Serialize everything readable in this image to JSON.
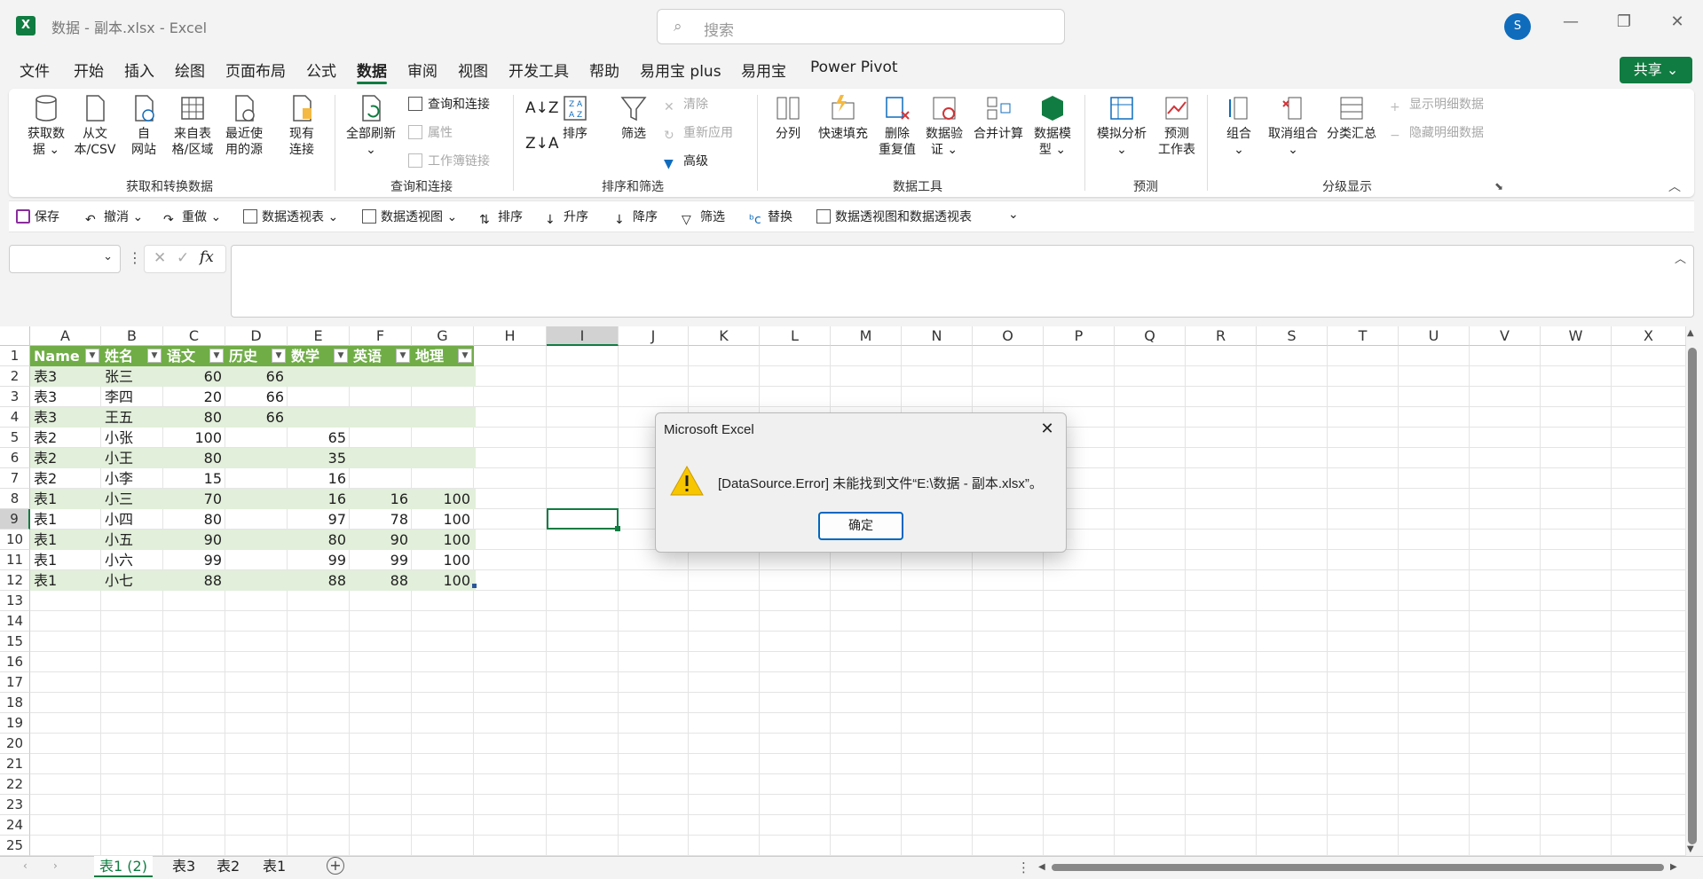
{
  "window": {
    "title": "数据 - 副本.xlsx  -  Excel",
    "logo": "X",
    "search_placeholder": "搜索",
    "avatar": "S"
  },
  "tabs": [
    "文件",
    "开始",
    "插入",
    "绘图",
    "页面布局",
    "公式",
    "数据",
    "审阅",
    "视图",
    "开发工具",
    "帮助",
    "易用宝 plus",
    "易用宝",
    "Power Pivot"
  ],
  "active_tab": "数据",
  "share_label": "共享",
  "ribbon": {
    "get_data": [
      "获取数",
      "据"
    ],
    "from_text": [
      "从文",
      "本/CSV"
    ],
    "from_web": [
      "自",
      "网站"
    ],
    "from_table": [
      "来自表",
      "格/区域"
    ],
    "recent": [
      "最近使",
      "用的源"
    ],
    "existing": [
      "现有",
      "连接"
    ],
    "refresh_all": [
      "全部刷新"
    ],
    "queries_connections": "查询和连接",
    "properties": "属性",
    "workbook_links": "工作簿链接",
    "sort": "排序",
    "filter": "筛选",
    "clear": "清除",
    "reapply": "重新应用",
    "advanced": "高级",
    "split": "分列",
    "flash_fill": "快速填充",
    "remove_dup": [
      "删除",
      "重复值"
    ],
    "validation": [
      "数据验",
      "证"
    ],
    "consolidate": "合并计算",
    "data_model": [
      "数据模",
      "型"
    ],
    "whatif": [
      "模拟分析"
    ],
    "forecast": [
      "预测",
      "工作表"
    ],
    "group": "组合",
    "ungroup": "取消组合",
    "subtotal": "分类汇总",
    "show_detail": "显示明细数据",
    "hide_detail": "隐藏明细数据",
    "groups": [
      "获取和转换数据",
      "查询和连接",
      "排序和筛选",
      "数据工具",
      "预测",
      "分级显示"
    ]
  },
  "qat": {
    "save": "保存",
    "undo": "撤消",
    "redo": "重做",
    "pivot_table": "数据透视表",
    "pivot_chart": "数据透视图",
    "sort": "排序",
    "asc": "升序",
    "desc": "降序",
    "filter": "筛选",
    "replace": "替换",
    "pivot_both": "数据透视图和数据透视表"
  },
  "formula_bar": {
    "fx": "fx"
  },
  "columns": [
    "A",
    "B",
    "C",
    "D",
    "E",
    "F",
    "G",
    "H",
    "I",
    "J",
    "K",
    "L",
    "M",
    "N",
    "O",
    "P",
    "Q",
    "R",
    "S",
    "T",
    "U",
    "V",
    "W",
    "X"
  ],
  "row_numbers": [
    "1",
    "2",
    "3",
    "4",
    "5",
    "6",
    "7",
    "8",
    "9",
    "10",
    "11",
    "12",
    "13",
    "14",
    "15",
    "16",
    "17",
    "18",
    "19",
    "20",
    "21",
    "22",
    "23",
    "24",
    "25"
  ],
  "table": {
    "headers": [
      "Name",
      "姓名",
      "语文",
      "历史",
      "数学",
      "英语",
      "地理"
    ],
    "rows": [
      [
        "表3",
        "张三",
        "60",
        "66",
        "",
        "",
        ""
      ],
      [
        "表3",
        "李四",
        "20",
        "66",
        "",
        "",
        ""
      ],
      [
        "表3",
        "王五",
        "80",
        "66",
        "",
        "",
        ""
      ],
      [
        "表2",
        "小张",
        "100",
        "",
        "65",
        "",
        ""
      ],
      [
        "表2",
        "小王",
        "80",
        "",
        "35",
        "",
        ""
      ],
      [
        "表2",
        "小李",
        "15",
        "",
        "16",
        "",
        ""
      ],
      [
        "表1",
        "小三",
        "70",
        "",
        "16",
        "16",
        "100"
      ],
      [
        "表1",
        "小四",
        "80",
        "",
        "97",
        "78",
        "100"
      ],
      [
        "表1",
        "小五",
        "90",
        "",
        "80",
        "90",
        "100"
      ],
      [
        "表1",
        "小六",
        "99",
        "",
        "99",
        "99",
        "100"
      ],
      [
        "表1",
        "小七",
        "88",
        "",
        "88",
        "88",
        "100"
      ]
    ]
  },
  "dialog": {
    "title": "Microsoft Excel",
    "message": "[DataSource.Error] 未能找到文件“E:\\数据 - 副本.xlsx”。",
    "ok": "确定"
  },
  "sheets": [
    "表1 (2)",
    "表3",
    "表2",
    "表1"
  ],
  "active_sheet": "表1 (2)"
}
